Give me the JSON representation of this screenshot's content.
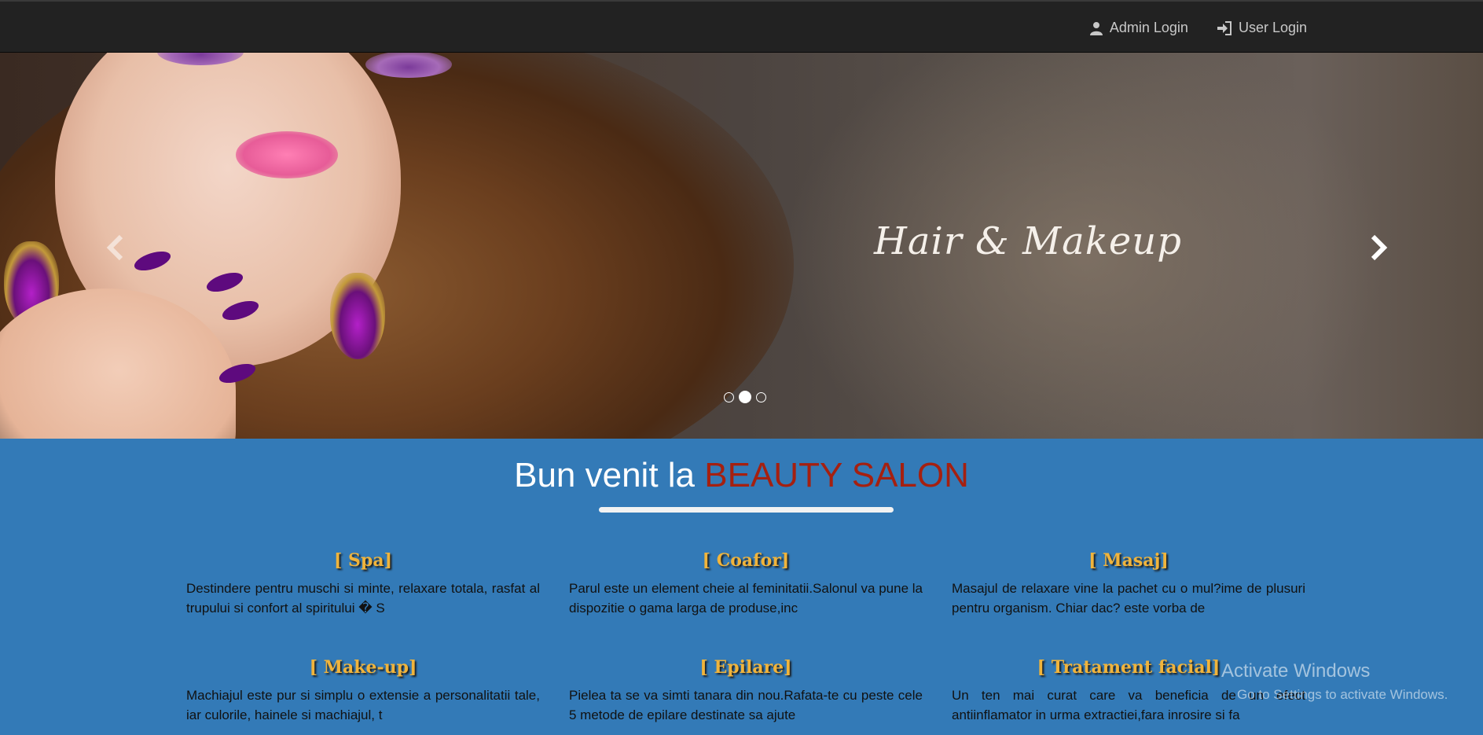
{
  "nav": {
    "admin_login": "Admin Login",
    "user_login": "User Login",
    "icons": [
      "user-icon",
      "login-icon"
    ]
  },
  "carousel": {
    "caption": "Hair & Makeup",
    "slide_count": 3,
    "active_index": 1
  },
  "welcome": {
    "prefix": "Bun venit la",
    "brand": "BEAUTY SALON",
    "brand_color": "#a52010"
  },
  "services": [
    {
      "title": "[ Spa]",
      "text": "Destindere pentru muschi si minte, relaxare totala, rasfat al trupului si confort al spiritului � S"
    },
    {
      "title": "[ Coafor]",
      "text": "Parul este un element cheie al feminitatii.Salonul va pune la dispozitie o gama larga de produse,inc"
    },
    {
      "title": "[ Masaj]",
      "text": "Masajul de relaxare vine la pachet cu o mul?ime de plusuri pentru organism. Chiar dac? este vorba de"
    },
    {
      "title": "[ Make-up]",
      "text": "Machiajul este pur si simplu o extensie a personalitatii tale, iar culorile, hainele si machiajul, t"
    },
    {
      "title": "[ Epilare]",
      "text": "Pielea ta se va simti tanara din nou.Rafata-te cu peste cele 5 metode de epilare destinate sa ajute"
    },
    {
      "title": "[ Tratament facial]",
      "text": "Un ten mai curat care va beneficia de un efect antiinflamator in urma extractiei,fara inrosire si fa"
    }
  ],
  "watermark": {
    "line1": "Activate Windows",
    "line2": "Go to Settings to activate Windows."
  },
  "colors": {
    "navbar": "#222222",
    "page_background": "#337ab7",
    "service_title": "#f0b43c"
  }
}
